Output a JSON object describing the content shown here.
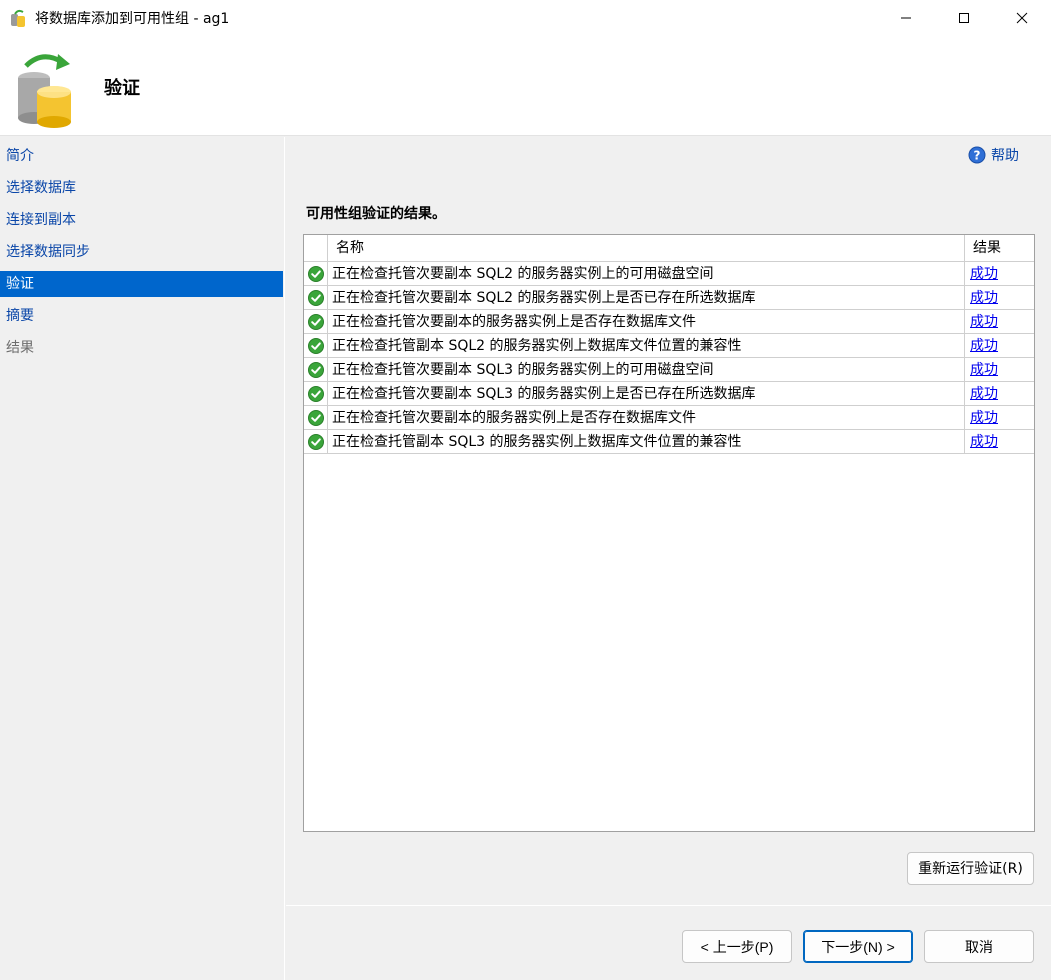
{
  "window": {
    "title": "将数据库添加到可用性组 - ag1",
    "icon": "database-wizard-icon"
  },
  "banner": {
    "title": "验证"
  },
  "sidebar": {
    "items": [
      {
        "label": "简介",
        "state": "link"
      },
      {
        "label": "选择数据库",
        "state": "link"
      },
      {
        "label": "连接到副本",
        "state": "link"
      },
      {
        "label": "选择数据同步",
        "state": "link"
      },
      {
        "label": "验证",
        "state": "active"
      },
      {
        "label": "摘要",
        "state": "link"
      },
      {
        "label": "结果",
        "state": "disabled"
      }
    ]
  },
  "help": {
    "label": "帮助"
  },
  "main": {
    "section_title": "可用性组验证的结果。",
    "columns": {
      "name": "名称",
      "result": "结果"
    },
    "rows": [
      {
        "name": "正在检查托管次要副本 SQL2 的服务器实例上的可用磁盘空间",
        "result": "成功"
      },
      {
        "name": "正在检查托管次要副本 SQL2 的服务器实例上是否已存在所选数据库",
        "result": "成功"
      },
      {
        "name": "正在检查托管次要副本的服务器实例上是否存在数据库文件",
        "result": "成功"
      },
      {
        "name": "正在检查托管副本 SQL2 的服务器实例上数据库文件位置的兼容性",
        "result": "成功"
      },
      {
        "name": "正在检查托管次要副本 SQL3 的服务器实例上的可用磁盘空间",
        "result": "成功"
      },
      {
        "name": "正在检查托管次要副本 SQL3 的服务器实例上是否已存在所选数据库",
        "result": "成功"
      },
      {
        "name": "正在检查托管次要副本的服务器实例上是否存在数据库文件",
        "result": "成功"
      },
      {
        "name": "正在检查托管副本 SQL3 的服务器实例上数据库文件位置的兼容性",
        "result": "成功"
      }
    ],
    "rerun_label": "重新运行验证(R)"
  },
  "footer": {
    "prev_label": "< 上一步(P)",
    "next_label": "下一步(N) >",
    "cancel_label": "取消"
  },
  "colors": {
    "accent": "#0066cc",
    "link": "#0a46a8",
    "success": "#3aa53a"
  }
}
